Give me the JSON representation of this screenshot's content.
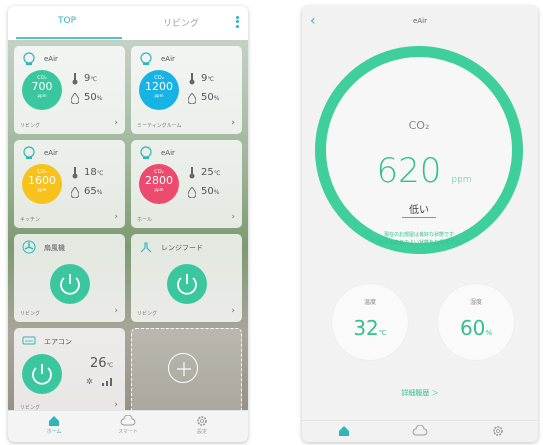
{
  "left": {
    "tabs": [
      {
        "label": "TOP",
        "active": true
      },
      {
        "label": "リビング",
        "active": false
      }
    ],
    "accent_color": "#2fb6b8",
    "sensor_cards": [
      {
        "name": "eAir",
        "co2_label": "CO₂",
        "co2": "700",
        "co2_unit": "ppm",
        "color": "#3bc79e",
        "temp": "9",
        "temp_unit": "℃",
        "humidity": "50",
        "humidity_unit": "%",
        "room": "リビング"
      },
      {
        "name": "eAir",
        "co2_label": "CO₂",
        "co2": "1200",
        "co2_unit": "ppm",
        "color": "#18b3e6",
        "temp": "9",
        "temp_unit": "℃",
        "humidity": "50",
        "humidity_unit": "%",
        "room": "ミーティングルーム"
      },
      {
        "name": "eAir",
        "co2_label": "CO₂",
        "co2": "1600",
        "co2_unit": "ppm",
        "color": "#f7c21c",
        "temp": "18",
        "temp_unit": "℃",
        "humidity": "65",
        "humidity_unit": "%",
        "room": "キッチン"
      },
      {
        "name": "eAir",
        "co2_label": "CO₂",
        "co2": "2800",
        "co2_unit": "ppm",
        "color": "#ec4a6e",
        "temp": "25",
        "temp_unit": "℃",
        "humidity": "50",
        "humidity_unit": "%",
        "room": "ホール"
      }
    ],
    "appliance_cards": [
      {
        "name": "扇風機",
        "icon": "fan-icon",
        "room": "リビング"
      },
      {
        "name": "レンジフード",
        "icon": "range-hood-icon",
        "room": "リビング"
      }
    ],
    "aircon_card": {
      "name": "エアコン",
      "icon": "air-conditioner-icon",
      "temp": "26",
      "temp_unit": "℃",
      "room": "リビング"
    },
    "nav": [
      {
        "label": "ホーム",
        "icon": "home-icon",
        "active": true
      },
      {
        "label": "スマート",
        "icon": "cloud-icon",
        "active": false
      },
      {
        "label": "設定",
        "icon": "gear-icon",
        "active": false
      }
    ]
  },
  "right": {
    "title": "eAir",
    "co2_label": "CO₂",
    "co2_value": "620",
    "co2_unit": "ppm",
    "level": "低い",
    "note_line1": "現在のお部屋は良好な状態です",
    "note_line2": "このまま換気のよい状態をお保ち下さい",
    "ring_color": "#3fcf9c",
    "temp_label": "温度",
    "temp_value": "32",
    "temp_unit": "℃",
    "humidity_label": "湿度",
    "humidity_value": "60",
    "humidity_unit": "%",
    "history_link": "詳細履歴 ＞",
    "nav": [
      {
        "icon": "home-icon",
        "active": true
      },
      {
        "icon": "cloud-icon",
        "active": false
      },
      {
        "icon": "gear-icon",
        "active": false
      }
    ]
  }
}
